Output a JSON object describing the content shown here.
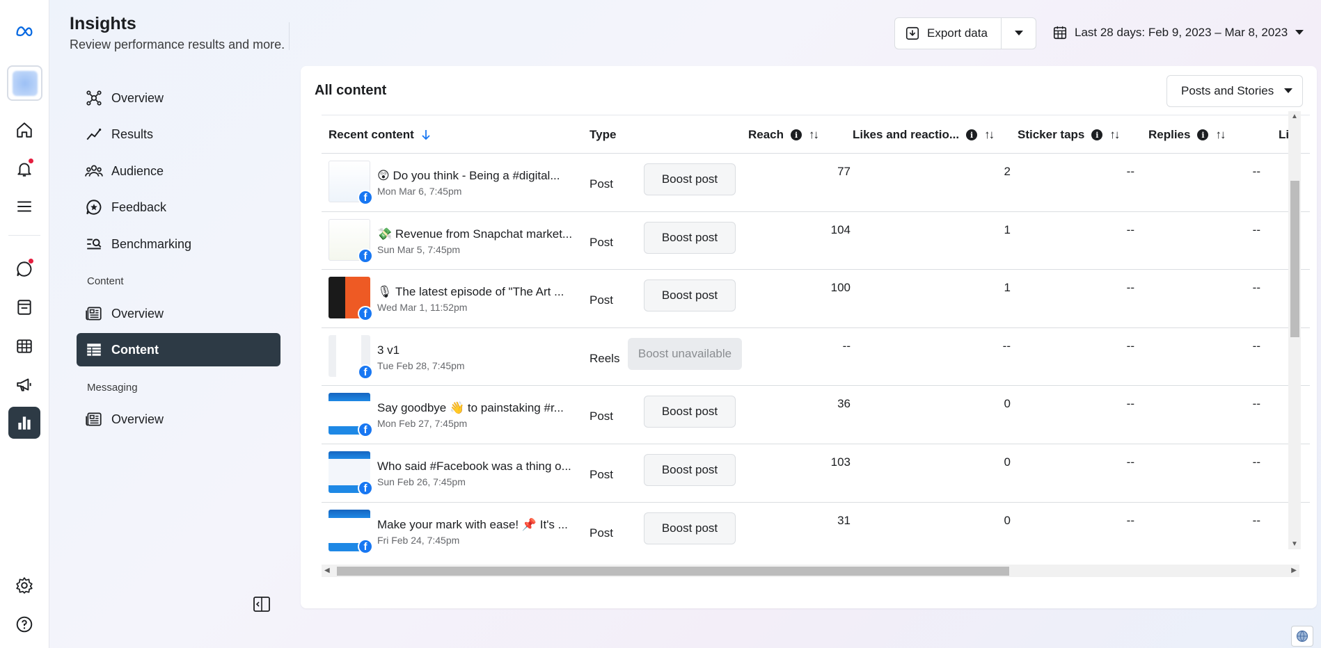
{
  "app": {
    "logo": "meta-logo"
  },
  "header": {
    "title": "Insights",
    "subtitle": "Review performance results and more.",
    "export_label": "Export data",
    "date_range": "Last 28 days: Feb 9, 2023 – Mar 8, 2023"
  },
  "nav": {
    "items": [
      {
        "label": "Overview",
        "icon": "graph-nodes-icon"
      },
      {
        "label": "Results",
        "icon": "trend-line-icon"
      },
      {
        "label": "Audience",
        "icon": "people-icon"
      },
      {
        "label": "Feedback",
        "icon": "chat-star-icon"
      },
      {
        "label": "Benchmarking",
        "icon": "search-list-icon"
      }
    ],
    "content_section": "Content",
    "content_items": [
      {
        "label": "Overview",
        "icon": "newspaper-icon"
      },
      {
        "label": "Content",
        "icon": "table-icon",
        "active": true
      }
    ],
    "messaging_section": "Messaging",
    "messaging_items": [
      {
        "label": "Overview",
        "icon": "newspaper-icon"
      }
    ]
  },
  "card": {
    "title": "All content",
    "filter": "Posts and Stories"
  },
  "table": {
    "columns": {
      "recent": "Recent content",
      "type": "Type",
      "reach": "Reach",
      "likes": "Likes and reactio...",
      "stickers": "Sticker taps",
      "replies": "Replies",
      "next": "Li"
    },
    "rows": [
      {
        "emoji": "😲",
        "title": "Do you think - Being a #digital...",
        "date": "Mon Mar 6, 7:45pm",
        "type": "Post",
        "boost": "Boost post",
        "reach": "77",
        "likes": "2",
        "stickers": "--",
        "replies": "--"
      },
      {
        "emoji": "💸",
        "title": "Revenue from Snapchat market...",
        "date": "Sun Mar 5, 7:45pm",
        "type": "Post",
        "boost": "Boost post",
        "reach": "104",
        "likes": "1",
        "stickers": "--",
        "replies": "--"
      },
      {
        "emoji": "🎙",
        "title": "The latest episode of \"The Art ...",
        "date": "Wed Mar 1, 11:52pm",
        "type": "Post",
        "boost": "Boost post",
        "reach": "100",
        "likes": "1",
        "stickers": "--",
        "replies": "--"
      },
      {
        "emoji": "",
        "title": "3 v1",
        "date": "Tue Feb 28, 7:45pm",
        "type": "Reels",
        "boost": "Boost unavailable",
        "reach": "--",
        "likes": "--",
        "stickers": "--",
        "replies": "--"
      },
      {
        "emoji": "",
        "title": "Say goodbye 👋 to painstaking #r...",
        "date": "Mon Feb 27, 7:45pm",
        "type": "Post",
        "boost": "Boost post",
        "reach": "36",
        "likes": "0",
        "stickers": "--",
        "replies": "--"
      },
      {
        "emoji": "",
        "title": "Who said #Facebook was a thing o...",
        "date": "Sun Feb 26, 7:45pm",
        "type": "Post",
        "boost": "Boost post",
        "reach": "103",
        "likes": "0",
        "stickers": "--",
        "replies": "--"
      },
      {
        "emoji": "",
        "title": "Make your mark with ease! 📌 It's ...",
        "date": "Fri Feb 24, 7:45pm",
        "type": "Post",
        "boost": "Boost post",
        "reach": "31",
        "likes": "0",
        "stickers": "--",
        "replies": "--"
      }
    ]
  },
  "colors": {
    "active_bg": "#2d3a45",
    "facebook_blue": "#1877f2",
    "notification_red": "#e41e3f"
  }
}
